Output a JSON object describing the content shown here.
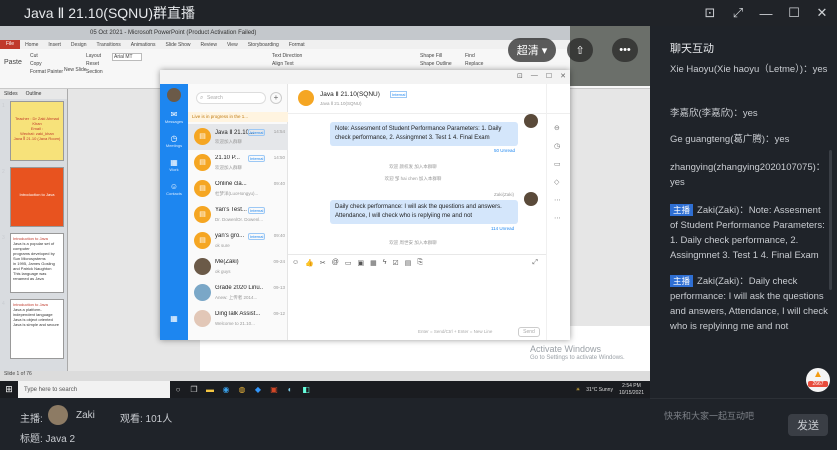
{
  "window": {
    "title": "Java Ⅱ 21.10(SQNU)群直播",
    "controls": [
      "⊡",
      "⤢",
      "—",
      "☐",
      "✕"
    ]
  },
  "video": {
    "quality_label": "超清 ▾",
    "share_icon": "⇧",
    "more_icon": "•••"
  },
  "ppt": {
    "title": "05 Oct 2021 - Microsoft PowerPoint (Product Activation Failed)",
    "tabs": [
      "File",
      "Home",
      "Insert",
      "Design",
      "Transitions",
      "Animations",
      "Slide Show",
      "Review",
      "View",
      "Storyboarding",
      "Format"
    ],
    "ribbon": {
      "cut": "Cut",
      "copy": "Copy",
      "format_painter": "Format Painter",
      "paste": "Paste",
      "new_slide": "New Slide",
      "layout": "Layout",
      "reset": "Reset",
      "section": "Section",
      "font": "Arial MT",
      "text_direction": "Text Direction",
      "align_text": "Align Text",
      "shape_fill": "Shape Fill",
      "shape_outline": "Shape Outline",
      "find": "Find",
      "replace": "Replace"
    },
    "pane_tabs": [
      "Slides",
      "Outline"
    ],
    "thumbs": [
      {
        "num": "1",
        "lines": [
          "Teacher : Dr Zaki Ahmad Khan",
          "Email :",
          "Wechat: zaki_khan",
          "Java Ⅱ 21.10 (Java Room)"
        ]
      },
      {
        "num": "2",
        "lines": [
          "Introduction to Java"
        ]
      },
      {
        "num": "3",
        "lines": [
          "Introduction to Java",
          "Java is a popular set of computer",
          "programs developed by Sun Microsystems",
          "in 1995, James Gosling and Patrick Naughton",
          "This language was renamed as Java"
        ]
      },
      {
        "num": "4",
        "lines": [
          "Introduction to Java",
          "Java a platform-independent language",
          "Java is object oriented",
          "Java is simple and secure"
        ]
      }
    ],
    "status": "Slide 1 of 76",
    "activate_title": "Activate Windows",
    "activate_sub": "Go to Settings to activate Windows."
  },
  "taskbar": {
    "search_placeholder": "Type here to search",
    "weather": "31°C Sunny",
    "time": "2:54 PM",
    "date": "10/15/2021"
  },
  "chat": {
    "nav": [
      "Messages",
      "Meetings",
      "Work",
      "Contacts"
    ],
    "search_placeholder": "Search",
    "banner": "Live is in progress in the 1...",
    "conversations": [
      {
        "name": "Java Ⅱ 21.10...",
        "tag": "Internal",
        "time": "14:54",
        "preview": "欢迎加入群聊"
      },
      {
        "name": "21.10 P...",
        "tag": "Internal",
        "time": "14:50",
        "preview": "欢迎加入群聊"
      },
      {
        "name": "Online cla...",
        "tag": "",
        "time": "09:40",
        "preview": "杜梦洋(LuoHongyu)..."
      },
      {
        "name": "Yan's Test...",
        "tag": "Internal",
        "time": "",
        "preview": "Dr. DowenlOr. Dowenl..."
      },
      {
        "name": "yan's gro...",
        "tag": "Internal",
        "time": "09:40",
        "preview": "ok sure"
      },
      {
        "name": "Me(Zaki)",
        "tag": "",
        "time": "09-24",
        "preview": "ok guys"
      },
      {
        "name": "Grade 2020 Linu...",
        "tag": "",
        "time": "09-13",
        "preview": "Anew: 上传者 2014..."
      },
      {
        "name": "DingTalk Assist...",
        "tag": "",
        "time": "09-12",
        "preview": "Welcome to 21.10..."
      }
    ],
    "header": {
      "name": "Java Ⅱ  21.10(SQNU)",
      "tag": "Internal",
      "sub": "Java Ⅱ  21.10(SQNU)"
    },
    "bubble1": "Note: Assesment of Student Performance Parameters: 1. Daily check performance, 2. Assingmnet 3. Test 1 4. Final Exam",
    "unread1": "50 Unread",
    "sys1": "欢迎 颜权发 加入本群聊",
    "sys2": "欢迎 邹 hai chen 加入本群聊",
    "sender": "Zaki(Zaki)",
    "bubble2": "Daily check performance: I will ask the questions and answers. Attendance, I will check who is replyiing me and not",
    "unread2": "114 Unread",
    "sys3": "欢迎 周世安 加入本群聊",
    "hint": "Enter = Send/Ctrl + Enter = New Line",
    "send": "Send"
  },
  "panel": {
    "title": "聊天互动",
    "messages": [
      {
        "host": false,
        "name": "Xie Haoyu(Xie haoyu（Letme）)",
        "text": "yes"
      },
      {
        "host": false,
        "name": "李嘉欣(李嘉欣)",
        "text": "yes"
      },
      {
        "host": false,
        "name": "Ge guangteng(葛广腾)",
        "text": "yes"
      },
      {
        "host": false,
        "name": "zhangying(zhangying2020107075)",
        "text": "yes"
      },
      {
        "host": true,
        "name": "Zaki(Zaki)",
        "text": "Note: Assesment of Student Performance Parameters: 1. Daily check performance, 2. Assingmnet 3. Test 1 4. Final Exam"
      },
      {
        "host": true,
        "name": "Zaki(Zaki)",
        "text": "Daily check performance: I will ask the questions and answers, Attendance, I will check who is replyinng me and not"
      }
    ],
    "host_tag": "主播",
    "likes": "2667",
    "input_placeholder": "快来和大家一起互动吧",
    "send": "发送"
  },
  "bottom": {
    "host_label": "主播:",
    "host_name": "Zaki",
    "viewers_label": "观看: 101人",
    "topic_label": "标题: Java 2"
  }
}
